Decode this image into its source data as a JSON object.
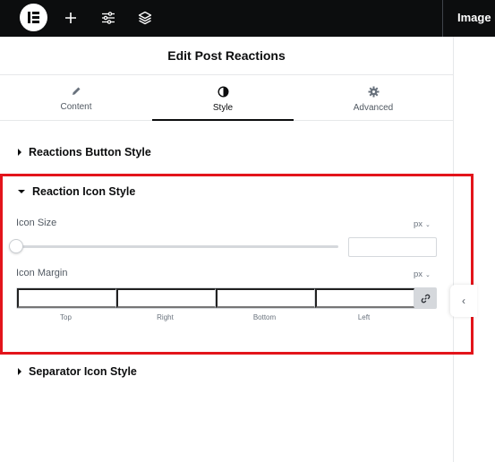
{
  "topbar": {
    "right_label": "Image B"
  },
  "panel": {
    "title": "Edit Post Reactions"
  },
  "tabs": [
    {
      "label": "Content",
      "icon": "pencil-icon"
    },
    {
      "label": "Style",
      "icon": "half-circle-icon",
      "active": true
    },
    {
      "label": "Advanced",
      "icon": "gear-icon"
    }
  ],
  "sections": {
    "reactions_button": "Reactions Button Style",
    "reaction_icon": "Reaction Icon Style",
    "separator_icon": "Separator Icon Style"
  },
  "controls": {
    "icon_size": {
      "label": "Icon Size",
      "unit": "px",
      "value": "",
      "slider_level": 0
    },
    "icon_margin": {
      "label": "Icon Margin",
      "unit": "px",
      "fields": [
        "Top",
        "Right",
        "Bottom",
        "Left"
      ],
      "values": [
        "",
        "",
        "",
        ""
      ]
    }
  },
  "colors": {
    "highlight_border": "#e3141b",
    "topbar_bg": "#0c0d0e"
  }
}
